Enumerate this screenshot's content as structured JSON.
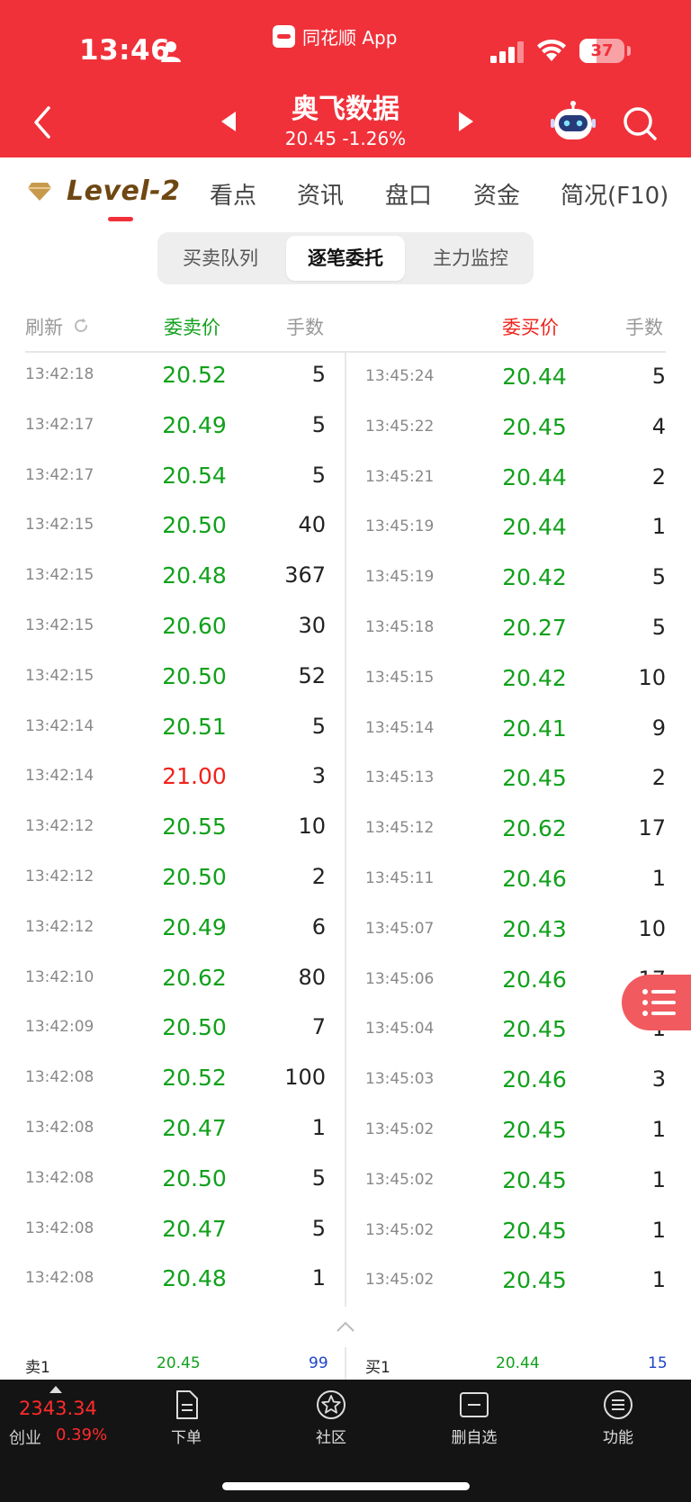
{
  "status_bar": {
    "time": "13:46",
    "app_name": "同花顺 App",
    "battery_level": "37",
    "battery_fraction": 0.37
  },
  "header": {
    "stock_name": "奥飞数据",
    "price": "20.45",
    "change_pct": "-1.26%"
  },
  "tabs": {
    "level2": "Level-2",
    "items": [
      "看点",
      "资讯",
      "盘口",
      "资金",
      "简况(F10)"
    ]
  },
  "segments": {
    "items": [
      "买卖队列",
      "逐笔委托",
      "主力监控"
    ],
    "active_index": 1
  },
  "table": {
    "refresh_label": "刷新",
    "sell_price_header": "委卖价",
    "sell_volume_header": "手数",
    "buy_price_header": "委买价",
    "buy_volume_header": "手数",
    "sell_rows": [
      {
        "time": "13:42:18",
        "price": "20.52",
        "volume": "5"
      },
      {
        "time": "13:42:17",
        "price": "20.49",
        "volume": "5"
      },
      {
        "time": "13:42:17",
        "price": "20.54",
        "volume": "5"
      },
      {
        "time": "13:42:15",
        "price": "20.50",
        "volume": "40"
      },
      {
        "time": "13:42:15",
        "price": "20.48",
        "volume": "367"
      },
      {
        "time": "13:42:15",
        "price": "20.60",
        "volume": "30"
      },
      {
        "time": "13:42:15",
        "price": "20.50",
        "volume": "52"
      },
      {
        "time": "13:42:14",
        "price": "20.51",
        "volume": "5"
      },
      {
        "time": "13:42:14",
        "price": "21.00",
        "volume": "3",
        "up": true
      },
      {
        "time": "13:42:12",
        "price": "20.55",
        "volume": "10"
      },
      {
        "time": "13:42:12",
        "price": "20.50",
        "volume": "2"
      },
      {
        "time": "13:42:12",
        "price": "20.49",
        "volume": "6"
      },
      {
        "time": "13:42:10",
        "price": "20.62",
        "volume": "80"
      },
      {
        "time": "13:42:09",
        "price": "20.50",
        "volume": "7"
      },
      {
        "time": "13:42:08",
        "price": "20.52",
        "volume": "100"
      },
      {
        "time": "13:42:08",
        "price": "20.47",
        "volume": "1"
      },
      {
        "time": "13:42:08",
        "price": "20.50",
        "volume": "5"
      },
      {
        "time": "13:42:08",
        "price": "20.47",
        "volume": "5"
      },
      {
        "time": "13:42:08",
        "price": "20.48",
        "volume": "1"
      }
    ],
    "buy_rows": [
      {
        "time": "13:45:24",
        "price": "20.44",
        "volume": "5"
      },
      {
        "time": "13:45:22",
        "price": "20.45",
        "volume": "4"
      },
      {
        "time": "13:45:21",
        "price": "20.44",
        "volume": "2"
      },
      {
        "time": "13:45:19",
        "price": "20.44",
        "volume": "1"
      },
      {
        "time": "13:45:19",
        "price": "20.42",
        "volume": "5"
      },
      {
        "time": "13:45:18",
        "price": "20.27",
        "volume": "5"
      },
      {
        "time": "13:45:15",
        "price": "20.42",
        "volume": "10"
      },
      {
        "time": "13:45:14",
        "price": "20.41",
        "volume": "9"
      },
      {
        "time": "13:45:13",
        "price": "20.45",
        "volume": "2"
      },
      {
        "time": "13:45:12",
        "price": "20.62",
        "volume": "17"
      },
      {
        "time": "13:45:11",
        "price": "20.46",
        "volume": "1"
      },
      {
        "time": "13:45:07",
        "price": "20.43",
        "volume": "10"
      },
      {
        "time": "13:45:06",
        "price": "20.46",
        "volume": "17"
      },
      {
        "time": "13:45:04",
        "price": "20.45",
        "volume": "1"
      },
      {
        "time": "13:45:03",
        "price": "20.46",
        "volume": "3"
      },
      {
        "time": "13:45:02",
        "price": "20.45",
        "volume": "1"
      },
      {
        "time": "13:45:02",
        "price": "20.45",
        "volume": "1"
      },
      {
        "time": "13:45:02",
        "price": "20.45",
        "volume": "1"
      },
      {
        "time": "13:45:02",
        "price": "20.45",
        "volume": "1"
      }
    ]
  },
  "summary": {
    "sell1_label": "卖1",
    "sell1_price": "20.45",
    "sell1_volume": "99",
    "buy1_label": "买1",
    "buy1_price": "20.44",
    "buy1_volume": "15"
  },
  "bottom_nav": {
    "index_value": "2343.34",
    "index_name": "创业",
    "index_pct": "0.39%",
    "items": [
      "下单",
      "社区",
      "删自选",
      "功能"
    ]
  },
  "colors": {
    "brand_red": "#f0313a",
    "price_green": "#11a11c",
    "price_red": "#f0231c",
    "level2_brown": "#6e4712"
  }
}
